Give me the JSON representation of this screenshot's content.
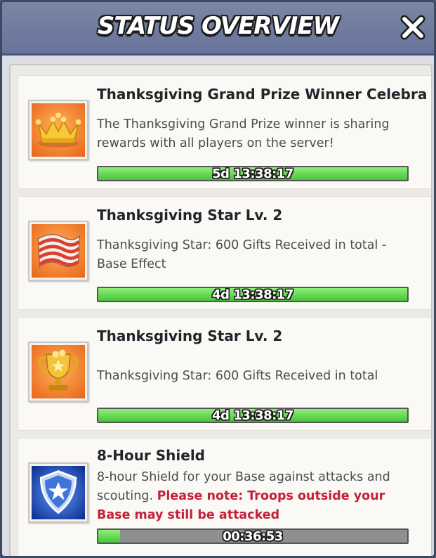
{
  "window": {
    "title": "STATUS OVERVIEW",
    "close_icon": "close-x-icon"
  },
  "colors": {
    "header": "#6f7b9e",
    "bar_fill": "#5bd24a",
    "bar_track": "#8f8f8f",
    "warning_text": "#c4213a"
  },
  "effects": [
    {
      "title": "Thanksgiving Grand Prize Winner Celebra",
      "description": "The Thanksgiving Grand Prize winner is sharing rewards with all players on the server!",
      "warning": "",
      "timer": "5d 13:38:17",
      "progress": 1.0,
      "icon": "golden-crown-icon"
    },
    {
      "title": "Thanksgiving Star Lv. 2",
      "description": "Thanksgiving Star: 600 Gifts Received in total - Base Effect",
      "warning": "",
      "timer": "4d 13:38:17",
      "progress": 1.0,
      "icon": "striped-flag-icon"
    },
    {
      "title": "Thanksgiving Star Lv. 2",
      "description": "Thanksgiving Star: 600 Gifts Received in total",
      "warning": "",
      "timer": "4d 13:38:17",
      "progress": 1.0,
      "icon": "gold-trophy-icon"
    },
    {
      "title": "8-Hour Shield",
      "description": "8-hour Shield for your Base against attacks and scouting.",
      "warning": "Please note: Troops outside your Base may still be attacked",
      "timer": "00:36:53",
      "progress": 0.07,
      "icon": "star-shield-icon"
    }
  ]
}
